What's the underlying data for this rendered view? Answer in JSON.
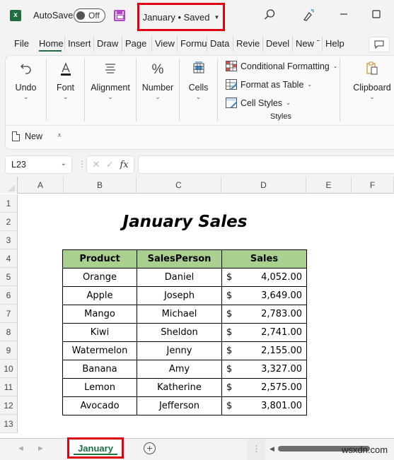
{
  "titlebar": {
    "app_icon": "excel-icon",
    "autosave_label": "AutoSave",
    "autosave_state": "Off",
    "save_icon": "save-icon",
    "document_title": "January • Saved",
    "search_icon": "search-icon",
    "designer_icon": "designer-wand-icon",
    "minimize_icon": "minimize-icon",
    "maximize_icon": "maximize-icon"
  },
  "menu": {
    "tabs": [
      {
        "label": "File"
      },
      {
        "label": "Home",
        "active": true
      },
      {
        "label": "Insert"
      },
      {
        "label": "Draw"
      },
      {
        "label": "Page"
      },
      {
        "label": "View"
      },
      {
        "label": "Formu"
      },
      {
        "label": "Data"
      },
      {
        "label": "Revie"
      },
      {
        "label": "Devel"
      },
      {
        "label": "New ˉ"
      },
      {
        "label": "Help"
      }
    ],
    "comments_icon": "comment-icon"
  },
  "ribbon": {
    "groups": [
      {
        "label": "Undo",
        "icon": "undo-icon"
      },
      {
        "label": "Font",
        "icon": "font-color-icon"
      },
      {
        "label": "Alignment",
        "icon": "align-center-icon"
      },
      {
        "label": "Number",
        "icon": "percent-icon"
      },
      {
        "label": "Cells",
        "icon": "cells-icon"
      }
    ],
    "styles": {
      "items": [
        {
          "label": "Conditional Formatting",
          "icon": "conditional-formatting-icon"
        },
        {
          "label": "Format as Table",
          "icon": "format-as-table-icon"
        },
        {
          "label": "Cell Styles",
          "icon": "cell-styles-icon"
        }
      ],
      "group_label": "Styles"
    },
    "clipboard": {
      "label": "Clipboard",
      "icon": "clipboard-icon"
    }
  },
  "quick_access": {
    "new_label": "New",
    "customize_icon": "customize-caret-icon"
  },
  "formula_bar": {
    "name_box": "L23",
    "cancel_icon": "✕",
    "enter_icon": "✓",
    "fx_label": "fx",
    "formula": ""
  },
  "grid": {
    "columns": [
      "A",
      "B",
      "C",
      "D",
      "E",
      "F"
    ],
    "rows": [
      "1",
      "2",
      "3",
      "4",
      "5",
      "6",
      "7",
      "8",
      "9",
      "10",
      "11",
      "12",
      "13"
    ],
    "title": "January Sales",
    "table": {
      "headers": [
        "Product",
        "SalesPerson",
        "Sales"
      ],
      "currency_symbol": "$",
      "rows": [
        {
          "product": "Orange",
          "salesperson": "Daniel",
          "sales": "4,052.00"
        },
        {
          "product": "Apple",
          "salesperson": "Joseph",
          "sales": "3,649.00"
        },
        {
          "product": "Mango",
          "salesperson": "Michael",
          "sales": "2,783.00"
        },
        {
          "product": "Kiwi",
          "salesperson": "Sheldon",
          "sales": "2,741.00"
        },
        {
          "product": "Watermelon",
          "salesperson": "Jenny",
          "sales": "2,155.00"
        },
        {
          "product": "Banana",
          "salesperson": "Amy",
          "sales": "3,327.00"
        },
        {
          "product": "Lemon",
          "salesperson": "Katherine",
          "sales": "2,575.00"
        },
        {
          "product": "Avocado",
          "salesperson": "Jefferson",
          "sales": "3,801.00"
        }
      ]
    }
  },
  "sheet_tabs": {
    "tabs": [
      {
        "label": "January",
        "active": true
      }
    ],
    "add_sheet_icon": "add-sheet-icon"
  },
  "watermark": "wsxdn.com",
  "colors": {
    "excel_green": "#1d6f42",
    "header_fill": "#a9d08e",
    "highlight_red": "#e0000f"
  }
}
